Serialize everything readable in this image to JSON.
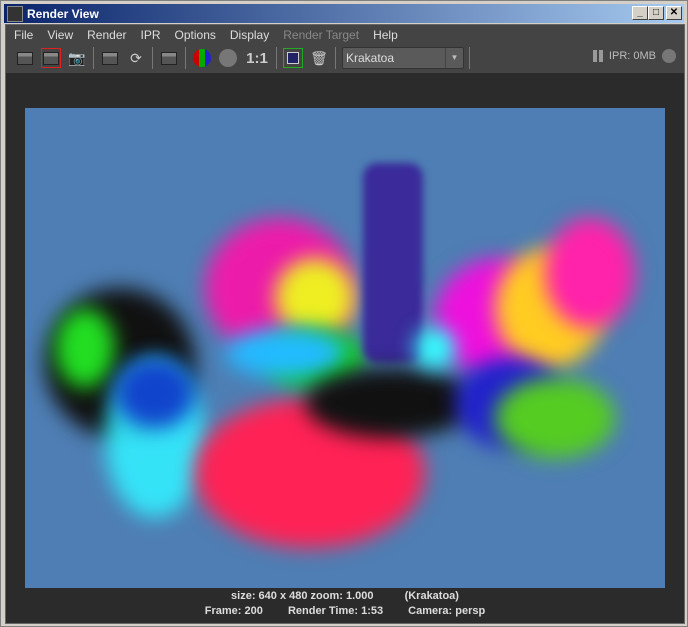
{
  "window": {
    "title": "Render View"
  },
  "menu": [
    "File",
    "View",
    "Render",
    "IPR",
    "Options",
    "Display",
    "Render Target",
    "Help"
  ],
  "toolbar": {
    "zoom_label": "1:1",
    "renderer": "Krakatoa",
    "ipr_status": "IPR: 0MB"
  },
  "status": {
    "line1_size": "size: 640 x 480 zoom: 1.000",
    "line1_renderer": "(Krakatoa)",
    "frame": "Frame: 200",
    "render_time": "Render Time:  1:53",
    "camera": "Camera: persp"
  }
}
